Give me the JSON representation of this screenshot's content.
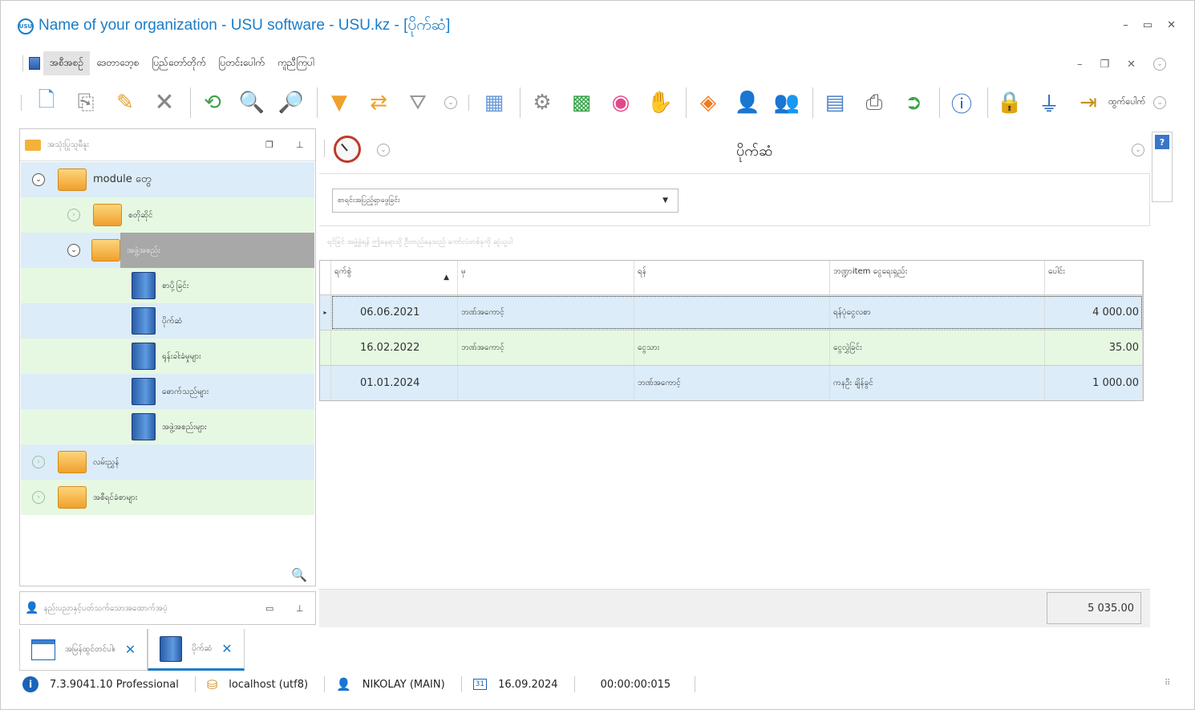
{
  "window": {
    "title": "Name of your organization - USU software - USU.kz - [ပိုက်ဆံ]",
    "logo_text": "USU"
  },
  "menu": {
    "items": [
      "အစီအစဉ်",
      "ဒေတာဘေ့စ",
      "ပြည်တော်တိုက်",
      "ပြတင်းပေါက်",
      "ကူညီကြပါ"
    ]
  },
  "toolbar": {
    "exit_label": "ထွက်ပေါက်"
  },
  "left_panel": {
    "header": "အသုံးပြုသူမီနူး",
    "tree": [
      {
        "label": "module တွေ",
        "level": 0,
        "expanded": true
      },
      {
        "label": "စတိုဆိုင်",
        "level": 1,
        "expanded": false
      },
      {
        "label": "အဖွဲ့အစည်း",
        "level": 1,
        "expanded": true,
        "selected": true
      },
      {
        "label": "စာပို့ခြင်း",
        "level": 2
      },
      {
        "label": "ပိုက်ဆံ",
        "level": 2
      },
      {
        "label": "ရုန်းခါးခံမှုများ",
        "level": 2
      },
      {
        "label": "ဓောက်သည်များ",
        "level": 2
      },
      {
        "label": "အဖွဲ့အစည်းများ",
        "level": 2
      },
      {
        "label": "လမ်းညွှန်",
        "level": 0,
        "expanded": false
      },
      {
        "label": "အစီရင်ခံစာများ",
        "level": 0,
        "expanded": false
      }
    ],
    "bottom_header": "နည်းပညာနှင့်ပတ်သက်သောအထောက်အပံ့"
  },
  "main": {
    "title": "ပိုက်ဆံ",
    "filter_placeholder": "စာရင်းအပြည့်ရှာဖွေခြင်း",
    "group_hint": "ရင်ခြင် အဖွဲ့ခွဲရန် ဤနေရာသို့ ဦးတည်နေသည် ကော်လံတစ်ခုကို ဆွဲယူပါ",
    "columns": [
      "ရက်စွဲ",
      "မှ",
      "ရန်",
      "ဘဏ္ဍာitem ငွေရေးရှည်း",
      "ပေါင်း"
    ],
    "rows": [
      {
        "date": "06.06.2021",
        "from": "ဘဏ်အကောင့်",
        "to": "",
        "item": "ရန်ပုံငွေလစာ",
        "amount": "4 000.00"
      },
      {
        "date": "16.02.2022",
        "from": "ဘဏ်အကောင့်",
        "to": "ငွေသား",
        "item": "ငွေလွှဲခြင်း",
        "amount": "35.00"
      },
      {
        "date": "01.01.2024",
        "from": "",
        "to": "ဘဏ်အကောင့်",
        "item": "ကနဦး ချိန်ခွင်",
        "amount": "1 000.00"
      }
    ],
    "total": "5 035.00"
  },
  "tabs": [
    {
      "label": "အမြန်ထွင်တင်ပါ။",
      "active": false
    },
    {
      "label": "ပိုက်ဆံ",
      "active": true
    }
  ],
  "status": {
    "version": "7.3.9041.10 Professional",
    "db": "localhost (utf8)",
    "user": "NIKOLAY (MAIN)",
    "calendar_day": "31",
    "date": "16.09.2024",
    "timer": "00:00:00:015"
  }
}
